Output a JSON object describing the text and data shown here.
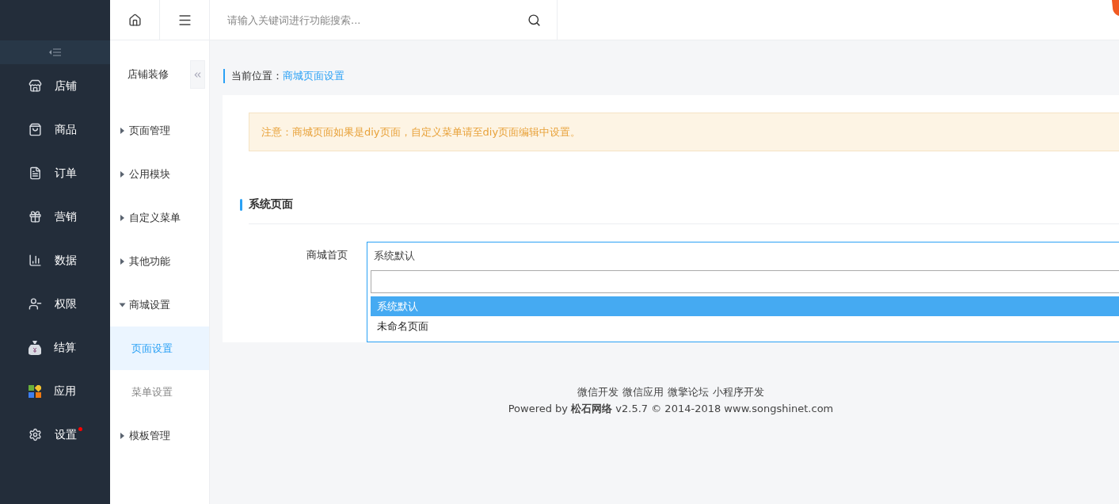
{
  "sidebar": {
    "items": [
      {
        "label": "店铺",
        "selected": false,
        "badge": false
      },
      {
        "label": "商品",
        "selected": false,
        "badge": false
      },
      {
        "label": "订单",
        "selected": false,
        "badge": false
      },
      {
        "label": "营销",
        "selected": false,
        "badge": false
      },
      {
        "label": "数据",
        "selected": false,
        "badge": false
      },
      {
        "label": "权限",
        "selected": false,
        "badge": false
      },
      {
        "label": "结算",
        "selected": false,
        "badge": false
      },
      {
        "label": "应用",
        "selected": false,
        "badge": false
      },
      {
        "label": "设置",
        "selected": false,
        "badge": true
      }
    ]
  },
  "search": {
    "placeholder": "请输入关键词进行功能搜索..."
  },
  "submenu": {
    "title": "店铺装修",
    "items": [
      {
        "label": "页面管理",
        "expanded": false
      },
      {
        "label": "公用模块",
        "expanded": false
      },
      {
        "label": "自定义菜单",
        "expanded": false
      },
      {
        "label": "其他功能",
        "expanded": false
      },
      {
        "label": "商城设置",
        "expanded": true,
        "children": [
          {
            "label": "页面设置",
            "selected": true
          },
          {
            "label": "菜单设置",
            "selected": false
          }
        ]
      },
      {
        "label": "模板管理",
        "expanded": false
      }
    ]
  },
  "breadcrumb": {
    "prefix": "当前位置：",
    "current": "商城页面设置"
  },
  "notice": "注意：商城页面如果是diy页面，自定义菜单请至diy页面编辑中设置。",
  "section": {
    "title": "系统页面",
    "fields": [
      {
        "label": "商城首页",
        "value": "系统默认",
        "options": [
          {
            "label": "系统默认",
            "selected": true
          },
          {
            "label": "未命名页面",
            "selected": false
          }
        ]
      }
    ]
  },
  "footer": {
    "links": [
      "微信开发",
      "微信应用",
      "微擎论坛",
      "小程序开发"
    ],
    "copyright": "Powered by **松石网络** v2.5.7 © 2014-2018 www.songshinet.com"
  }
}
